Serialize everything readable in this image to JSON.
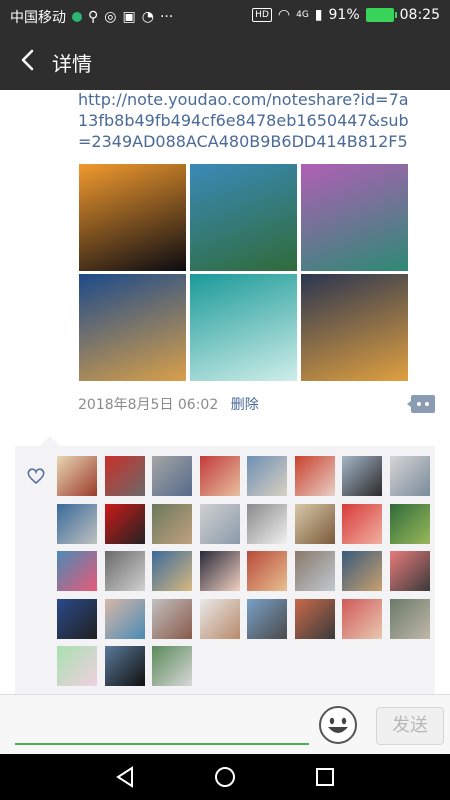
{
  "status": {
    "carrier": "中国移动",
    "signal_label": "4G",
    "battery": "91%",
    "time": "08:25",
    "hd": "HD",
    "more": "···"
  },
  "nav": {
    "title": "详情"
  },
  "post": {
    "link": "http://note.youdao.com/noteshare?id=7a13fb8b49fb494cf6e8478eb1650447&sub=2349AD088ACA480B9B6DD414B812F5",
    "date": "2018年8月5日 06:02",
    "delete_label": "删除"
  },
  "photos": [
    {
      "name": "sunset-crane",
      "c1": "#f29a2e",
      "c2": "#0b0b12"
    },
    {
      "name": "lagoon-paraglider",
      "c1": "#3a8ab8",
      "c2": "#2f6b3a"
    },
    {
      "name": "lakes-waterfall",
      "c1": "#b05fb5",
      "c2": "#2d8a74"
    },
    {
      "name": "harbor-night",
      "c1": "#1c4a8a",
      "c2": "#d9a04a"
    },
    {
      "name": "wave-surfer",
      "c1": "#1a9a98",
      "c2": "#cfeee9"
    },
    {
      "name": "town-dusk",
      "c1": "#2a3550",
      "c2": "#e0a040"
    }
  ],
  "likes": {
    "avatar_colors": [
      [
        "#e9d8b5",
        "#9a3a2a"
      ],
      [
        "#c9302b",
        "#6a6a6a"
      ],
      [
        "#a5a5a5",
        "#556b8a"
      ],
      [
        "#c23a3a",
        "#e8c0a0"
      ],
      [
        "#6e8fb5",
        "#d8d0c0"
      ],
      [
        "#c9402b",
        "#e8d0c8"
      ],
      [
        "#a5b5c8",
        "#2b2b2b"
      ],
      [
        "#d5d5d5",
        "#7a8a9a"
      ],
      [
        "#3a6a9a",
        "#c0c0c0"
      ],
      [
        "#cc1a1a",
        "#222222"
      ],
      [
        "#6a7a5a",
        "#c0a080"
      ],
      [
        "#d0d0d0",
        "#8a9aaa"
      ],
      [
        "#8a8a8a",
        "#f0f0f0"
      ],
      [
        "#d8c8a8",
        "#7a5a3a"
      ],
      [
        "#d83a3a",
        "#f0b0a0"
      ],
      [
        "#2f6b3a",
        "#9ab85a"
      ],
      [
        "#4a8ab5",
        "#e85a7a"
      ],
      [
        "#6a6a6a",
        "#d0d0d0"
      ],
      [
        "#3a6a9a",
        "#d8b880"
      ],
      [
        "#2a2a3a",
        "#f0d0c0"
      ],
      [
        "#b84a3a",
        "#e8c090"
      ],
      [
        "#8a7a6a",
        "#c0c8d0"
      ],
      [
        "#3a5a7a",
        "#c8a070"
      ],
      [
        "#e87a7a",
        "#3a3a3a"
      ],
      [
        "#2a4a8a",
        "#202020"
      ],
      [
        "#d8b8a8",
        "#4a8ab5"
      ],
      [
        "#c0c0c0",
        "#8a5a4a"
      ],
      [
        "#e8e8e8",
        "#b88a6a"
      ],
      [
        "#7aa0c8",
        "#4a4a4a"
      ],
      [
        "#c86a4a",
        "#3a3a3a"
      ],
      [
        "#d05a5a",
        "#e8c8b0"
      ],
      [
        "#6a7a6a",
        "#c0b8a8"
      ],
      [
        "#a8e0b0",
        "#f0d0e0"
      ],
      [
        "#5a7a9a",
        "#101010"
      ],
      [
        "#5a8a5a",
        "#d8d8d8"
      ]
    ]
  },
  "input": {
    "send_label": "发送"
  },
  "colors": {
    "accent_green": "#4caf50",
    "link_blue": "#4a6a98",
    "bar_dark": "#2e2e2e"
  }
}
